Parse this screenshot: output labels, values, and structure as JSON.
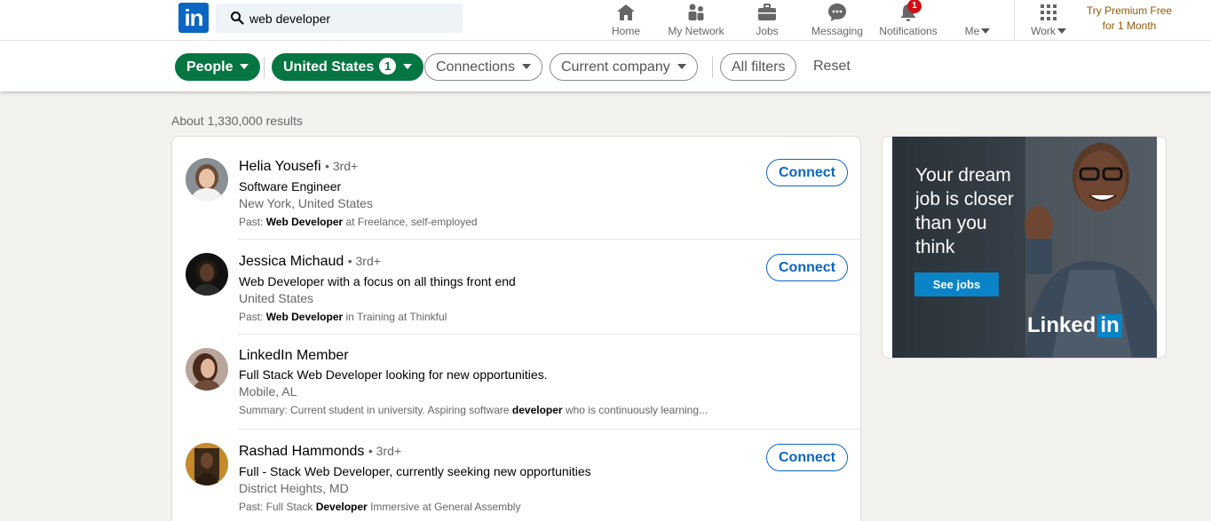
{
  "app": {
    "logo_text": "in",
    "brand_color": "#0a66c2"
  },
  "search": {
    "value": "web developer",
    "icon": "search-icon"
  },
  "nav": {
    "items": [
      {
        "label": "Home",
        "icon": "home-icon"
      },
      {
        "label": "My Network",
        "icon": "network-icon"
      },
      {
        "label": "Jobs",
        "icon": "briefcase-icon"
      },
      {
        "label": "Messaging",
        "icon": "chat-icon"
      },
      {
        "label": "Notifications",
        "icon": "bell-icon",
        "badge": "1"
      },
      {
        "label": "Me",
        "icon": "chevron-down-icon"
      },
      {
        "label": "Work",
        "icon": "grid-icon"
      }
    ],
    "premium_line1": "Try Premium Free",
    "premium_line2": "for 1 Month"
  },
  "filters": {
    "people": "People",
    "location": "United States",
    "location_count": "1",
    "connections": "Connections",
    "current_company": "Current company",
    "all_filters": "All filters",
    "reset": "Reset",
    "active_color": "#057642"
  },
  "results": {
    "count_text": "About 1,330,000 results",
    "items": [
      {
        "name": "Helia Yousefi",
        "degree": "• 3rd+",
        "headline": "Software Engineer",
        "location": "New York, United States",
        "snippet_prefix": "Past: ",
        "snippet_bold": "Web Developer",
        "snippet_suffix": " at Freelance, self-employed",
        "action": "Connect"
      },
      {
        "name": "Jessica Michaud",
        "degree": "• 3rd+",
        "headline": "Web Developer with a focus on all things front end",
        "location": "United States",
        "snippet_prefix": "Past: ",
        "snippet_bold": "Web Developer",
        "snippet_suffix": " in Training at Thinkful",
        "action": "Connect"
      },
      {
        "name": "LinkedIn Member",
        "degree": "",
        "headline": "Full Stack Web Developer looking for new opportunities.",
        "location": "Mobile, AL",
        "snippet_prefix": "Summary: Current student in university. Aspiring software ",
        "snippet_bold": "developer",
        "snippet_suffix": " who is continuously learning...",
        "action": ""
      },
      {
        "name": "Rashad Hammonds",
        "degree": "• 3rd+",
        "headline": "Full - Stack Web Developer, currently seeking new opportunities",
        "location": "District Heights, MD",
        "snippet_prefix": "Past: Full Stack ",
        "snippet_bold": "Developer",
        "snippet_suffix": " Immersive at General Assembly",
        "action": "Connect"
      }
    ]
  },
  "ad": {
    "headline": "Your dream job is closer than you think",
    "button": "See jobs",
    "logo_word": "Linked",
    "logo_in": "in"
  }
}
